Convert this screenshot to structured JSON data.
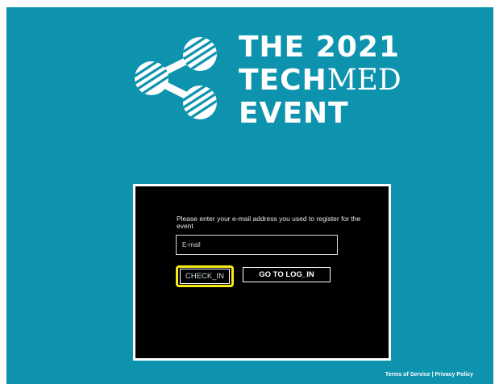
{
  "brand": {
    "title_lines": [
      "THE 2021",
      "TECH",
      "MED",
      "EVENT"
    ],
    "primary_color": "#0e93ae",
    "logo_icon": "share-nodes-icon"
  },
  "form": {
    "prompt": "Please enter your e-mail address you used to register for the event",
    "email_placeholder": "E-mail",
    "email_value": "",
    "checkin_label": "CHECK_IN",
    "login_label": "GO TO LOG_IN",
    "highlight_color": "#f6ea16"
  },
  "footer": {
    "terms_label": "Terms of Service",
    "separator": "|",
    "privacy_label": "Privacy Policy"
  }
}
